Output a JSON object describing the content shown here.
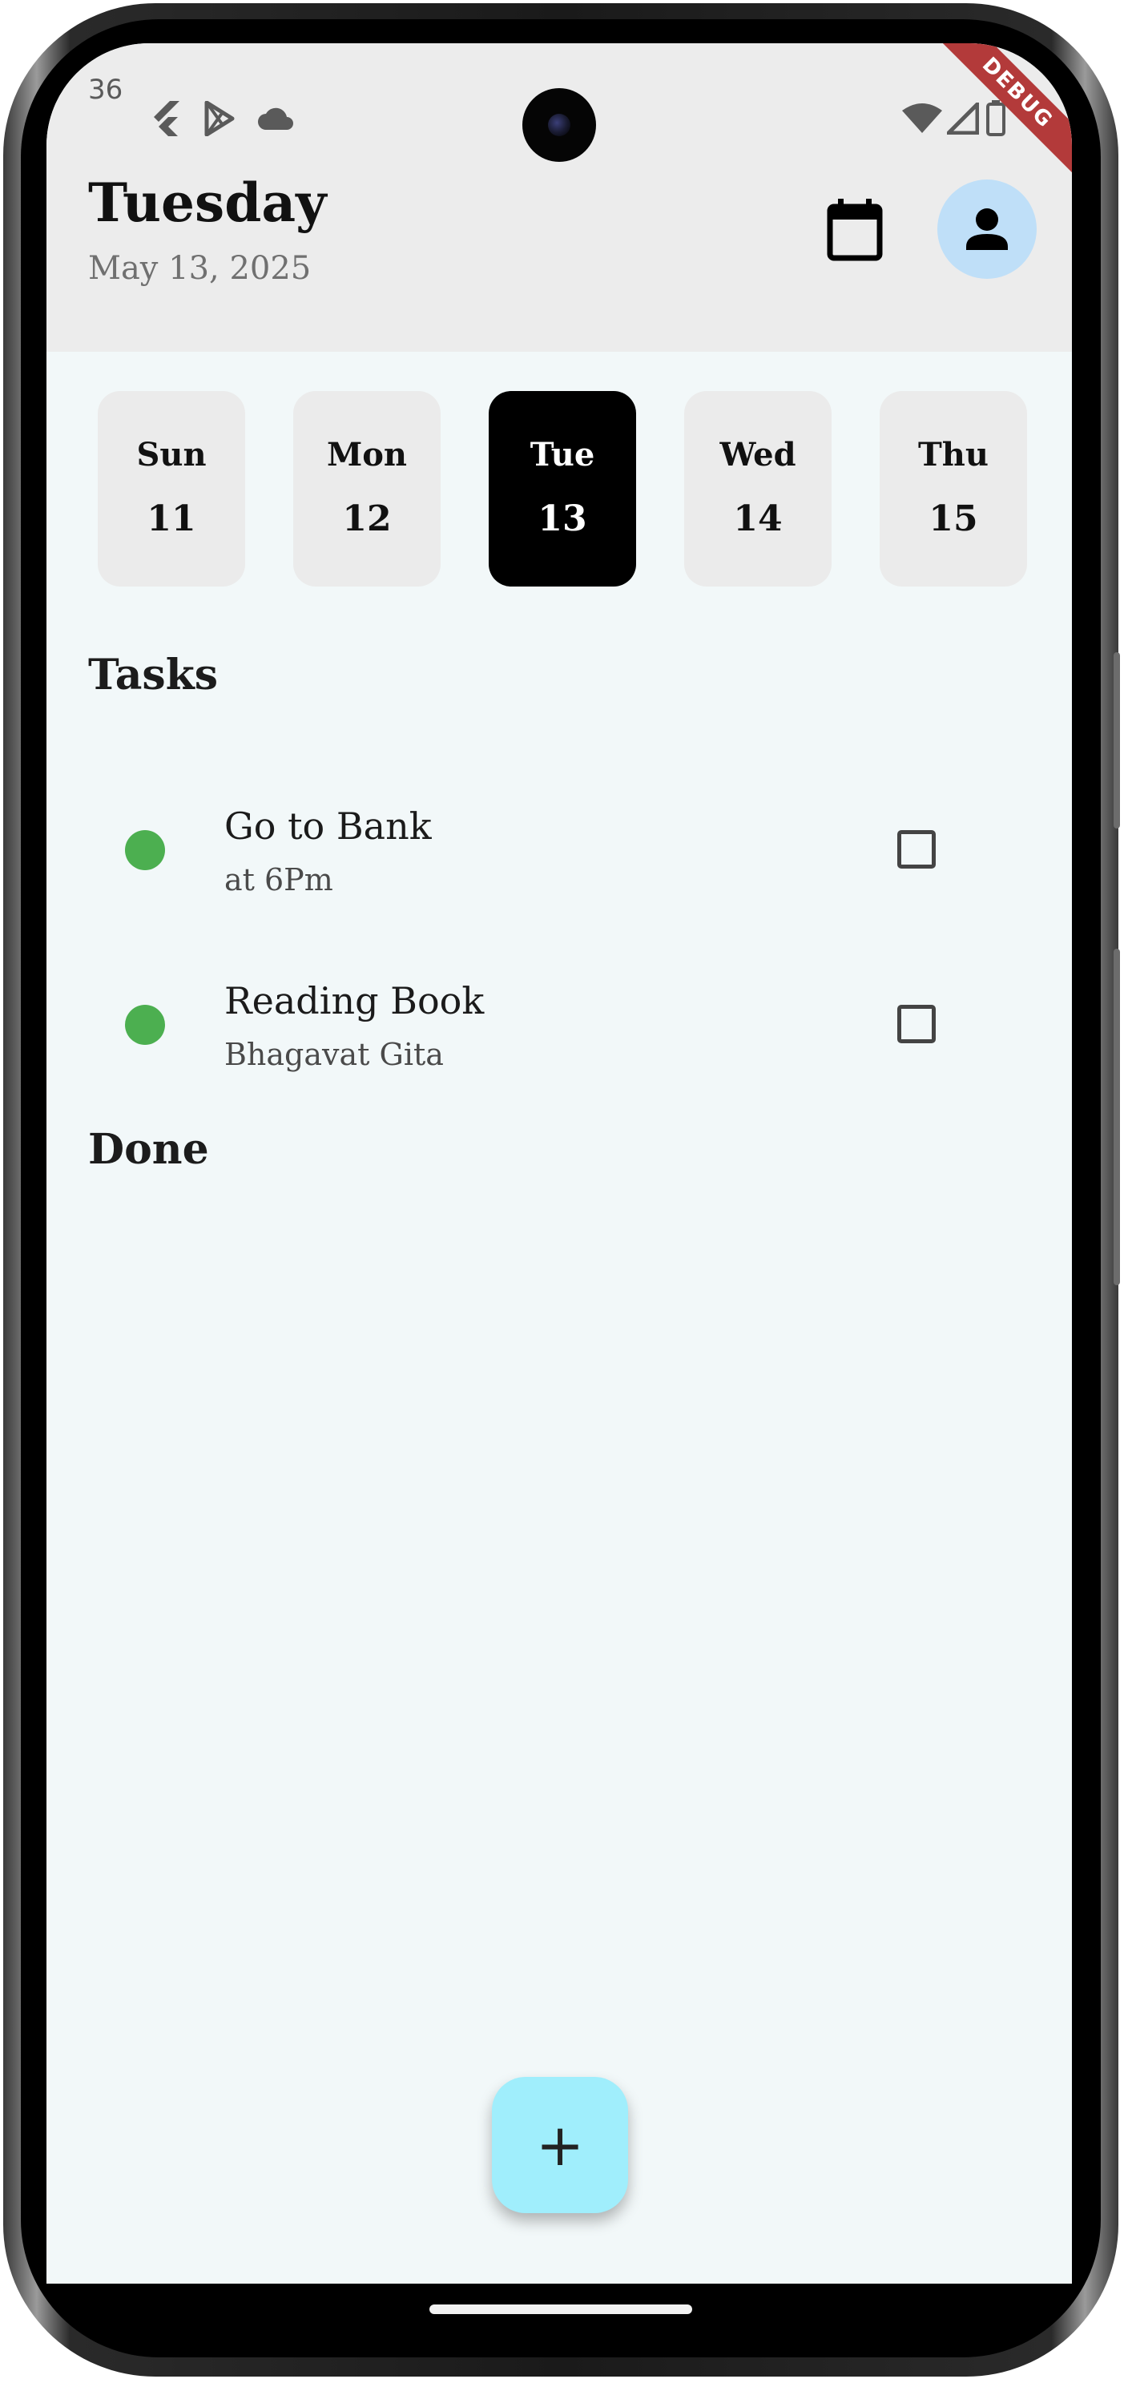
{
  "status_bar": {
    "time": "36",
    "icons": [
      "flutter-icon",
      "play-store-icon",
      "cloud-icon",
      "wifi-icon",
      "signal-icon",
      "battery-icon"
    ]
  },
  "header": {
    "day": "Tuesday",
    "date": "May 13, 2025",
    "debug_banner": "DEBUG"
  },
  "days": [
    {
      "name": "Sun",
      "num": "11",
      "selected": false
    },
    {
      "name": "Mon",
      "num": "12",
      "selected": false
    },
    {
      "name": "Tue",
      "num": "13",
      "selected": true
    },
    {
      "name": "Wed",
      "num": "14",
      "selected": false
    },
    {
      "name": "Thu",
      "num": "15",
      "selected": false
    }
  ],
  "sections": {
    "tasks": "Tasks",
    "done": "Done"
  },
  "tasks": [
    {
      "title": "Go to Bank",
      "subtitle": "at 6Pm",
      "checked": false,
      "dot_color": "#4caf50"
    },
    {
      "title": "Reading Book",
      "subtitle": "Bhagavat Gita",
      "checked": false,
      "dot_color": "#4caf50"
    }
  ],
  "fab": {
    "label": "+"
  },
  "colors": {
    "header_bg": "#ececec",
    "screen_bg": "#f2f8f9",
    "selected_day_bg": "#000000",
    "avatar_bg": "#bfdff8",
    "fab_bg": "#a0eefc",
    "debug_banner": "#b33a3a"
  }
}
